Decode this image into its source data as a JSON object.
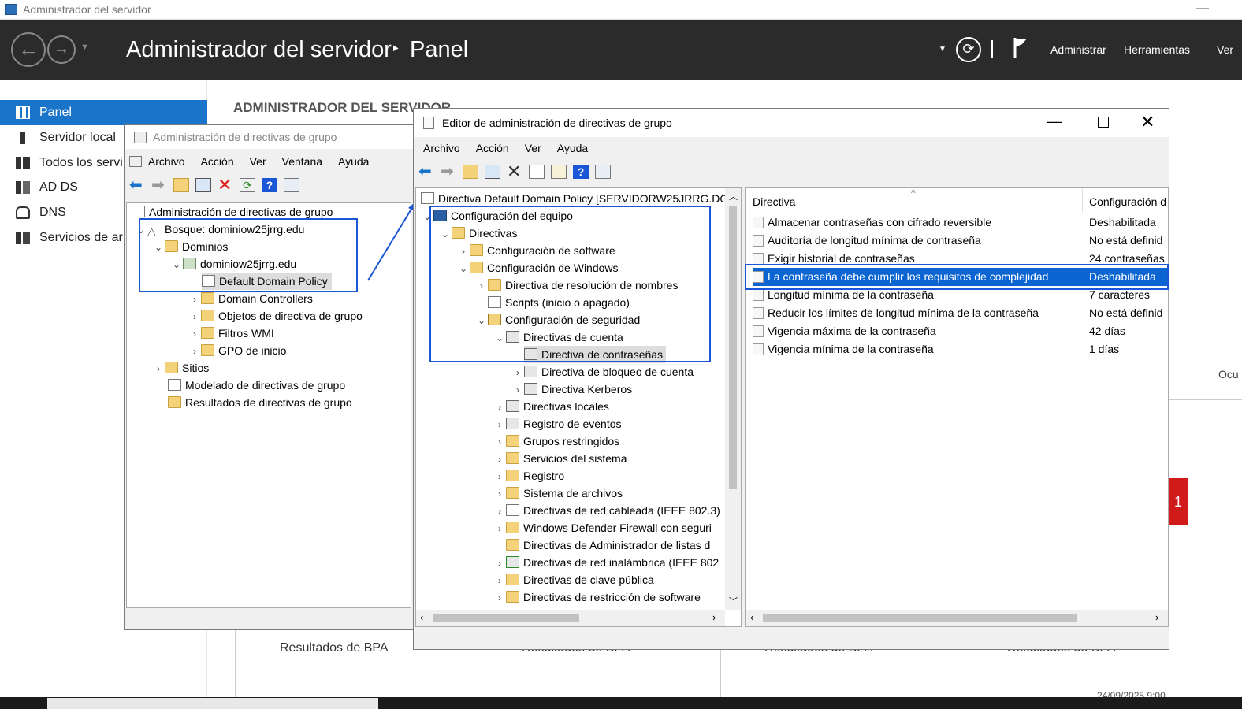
{
  "server_manager": {
    "window_title": "Administrador del servidor",
    "header_app": "Administrador del servidor",
    "header_sep": "‣",
    "header_page": "Panel",
    "menu": [
      "Administrar",
      "Herramientas",
      "Ver"
    ],
    "nav": [
      "Panel",
      "Servidor local",
      "Todos los servi",
      "AD DS",
      "DNS",
      "Servicios de ar"
    ],
    "section_title": "ADMINISTRADOR DEL SERVIDOR",
    "bpa": [
      "Resultados de BPA",
      "Resultados de BPA",
      "Resultados de BPA",
      "Resultados de BPA"
    ],
    "right_text": "Ocu",
    "red_badge": "1",
    "date": "24/09/2025 9:00"
  },
  "gpmc": {
    "title": "Administración de directivas de grupo",
    "menu": [
      "Archivo",
      "Acción",
      "Ver",
      "Ventana",
      "Ayuda"
    ],
    "tree": [
      "Administración de directivas de grupo",
      "Bosque: dominiow25jrrg.edu",
      "Dominios",
      "dominiow25jrrg.edu",
      "Default Domain Policy",
      "Domain Controllers",
      "Objetos de directiva de grupo",
      "Filtros WMI",
      "GPO de inicio",
      "Sitios",
      "Modelado de directivas de grupo",
      "Resultados de directivas de grupo"
    ]
  },
  "gpme": {
    "title": "Editor de administración de directivas de grupo",
    "menu": [
      "Archivo",
      "Acción",
      "Ver",
      "Ayuda"
    ],
    "tree": [
      "Directiva Default Domain Policy [SERVIDORW25JRRG.DO",
      "Configuración del equipo",
      "Directivas",
      "Configuración de software",
      "Configuración de Windows",
      "Directiva de resolución de nombres",
      "Scripts (inicio o apagado)",
      "Configuración de seguridad",
      "Directivas de cuenta",
      "Directiva de contraseñas",
      "Directiva de bloqueo de cuenta",
      "Directiva Kerberos",
      "Directivas locales",
      "Registro de eventos",
      "Grupos restringidos",
      "Servicios del sistema",
      "Registro",
      "Sistema de archivos",
      "Directivas de red cableada (IEEE 802.3)",
      "Windows Defender Firewall con seguri",
      "Directivas de Administrador de listas d",
      "Directivas de red inalámbrica (IEEE 802",
      "Directivas de clave pública",
      "Directivas de restricción de software"
    ],
    "list_headers": [
      "Directiva",
      "Configuración d"
    ],
    "list": [
      {
        "name": "Almacenar contraseñas con cifrado reversible",
        "value": "Deshabilitada"
      },
      {
        "name": "Auditoría de longitud mínima de contraseña",
        "value": "No está definid"
      },
      {
        "name": "Exigir historial de contraseñas",
        "value": "24 contraseñas"
      },
      {
        "name": "La contraseña debe cumplir los requisitos de complejidad",
        "value": "Deshabilitada"
      },
      {
        "name": "Longitud mínima de la contraseña",
        "value": "7 caracteres"
      },
      {
        "name": "Reducir los límites de longitud mínima de la contraseña",
        "value": "No está definid"
      },
      {
        "name": "Vigencia máxima de la contraseña",
        "value": "42 días"
      },
      {
        "name": "Vigencia mínima de la contraseña",
        "value": "1 días"
      }
    ]
  },
  "colors": {
    "accent": "#1a56d6",
    "nav_selected": "#1a74c9",
    "header_bg": "#2b2b2b",
    "badge": "#d11b1b"
  }
}
